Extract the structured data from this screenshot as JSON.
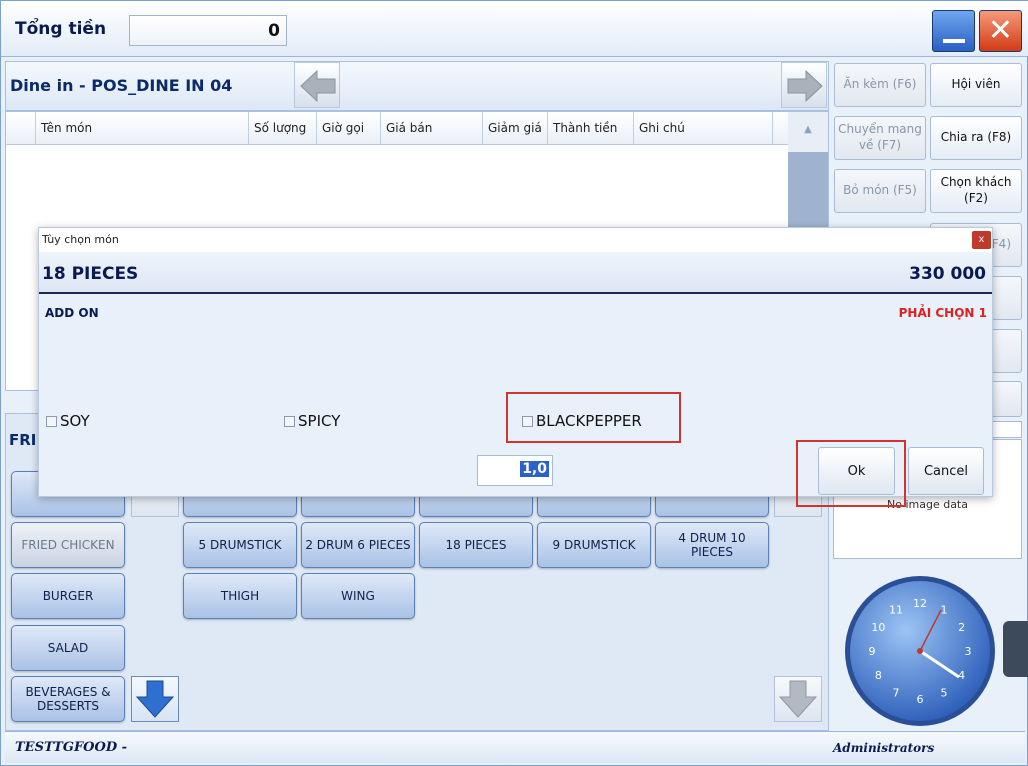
{
  "topbar": {
    "total_label": "Tổng tiền",
    "total_value": "0"
  },
  "order": {
    "title": "Dine in - POS_DINE IN 04",
    "columns": [
      "Tên món",
      "Số lượng",
      "Giờ gọi",
      "Giá bán",
      "Giảm giá",
      "Thành tiền",
      "Ghi chú"
    ]
  },
  "side_buttons": [
    {
      "label": "Ăn kèm (F6)",
      "enabled": false
    },
    {
      "label": "Hội viên",
      "enabled": true
    },
    {
      "label": "Chuyển mang về (F7)",
      "enabled": false
    },
    {
      "label": "Chia ra (F8)",
      "enabled": true
    },
    {
      "label": "Bỏ món (F5)",
      "enabled": false
    },
    {
      "label": "Chọn khách (F2)",
      "enabled": true
    },
    {
      "label": "F4)",
      "enabled": false
    }
  ],
  "categories": {
    "current_label": "FRI",
    "items": [
      "FRIED CHICKEN",
      "BURGER",
      "SALAD",
      "BEVERAGES & DESSERTS"
    ],
    "selected": "FRIED CHICKEN"
  },
  "products": [
    "5 DRUMSTICK",
    "2 DRUM 6 PIECES",
    "18 PIECES",
    "9 DRUMSTICK",
    "4 DRUM 10 PIECES",
    "THIGH",
    "WING"
  ],
  "image_panel": {
    "no_image_text": "No image data"
  },
  "status": {
    "left": "TESTTGFOOD -",
    "right": "Administrators"
  },
  "modal": {
    "title": "Tùy chọn món",
    "close": "x",
    "item_name": "18 PIECES",
    "item_price": "330 000",
    "group_label": "ADD ON",
    "requirement": "PHẢI CHỌN 1",
    "options": [
      "SOY",
      "SPICY",
      "BLACKPEPPER"
    ],
    "quantity": "1,0",
    "ok_label": "Ok",
    "cancel_label": "Cancel"
  },
  "colors": {
    "accent": "#0a1a50",
    "highlight": "#d0342c",
    "required_text": "#e02020",
    "button_blue": "#a9c2e6"
  },
  "clock": {
    "numbers": [
      "12",
      "1",
      "2",
      "3",
      "4",
      "5",
      "6",
      "7",
      "8",
      "9",
      "10",
      "11"
    ]
  }
}
